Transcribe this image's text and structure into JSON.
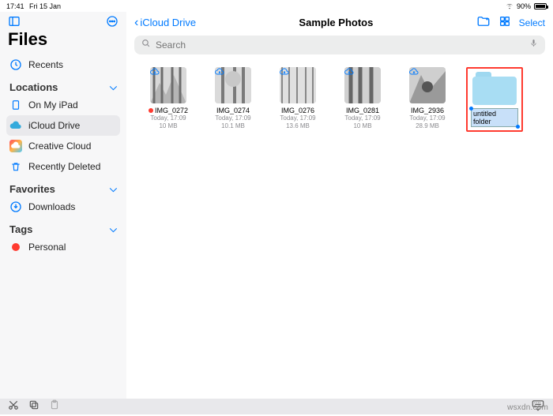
{
  "status": {
    "time": "17:41",
    "date": "Fri 15 Jan",
    "battery": "90%"
  },
  "sidebar": {
    "app": "Files",
    "recents": "Recents",
    "sections": {
      "locations": {
        "title": "Locations",
        "ipad": "On My iPad",
        "icloud": "iCloud Drive",
        "cc": "Creative Cloud",
        "deleted": "Recently Deleted"
      },
      "favorites": {
        "title": "Favorites",
        "downloads": "Downloads"
      },
      "tags": {
        "title": "Tags",
        "personal": "Personal"
      }
    }
  },
  "nav": {
    "back": "iCloud Drive",
    "title": "Sample Photos",
    "select": "Select"
  },
  "search": {
    "placeholder": "Search"
  },
  "files": [
    {
      "name": "IMG_0272",
      "date": "Today, 17:09",
      "size": "10 MB",
      "tagged": true
    },
    {
      "name": "IMG_0274",
      "date": "Today, 17:09",
      "size": "10.1 MB",
      "tagged": false
    },
    {
      "name": "IMG_0276",
      "date": "Today, 17:09",
      "size": "13.6 MB",
      "tagged": false
    },
    {
      "name": "IMG_0281",
      "date": "Today, 17:09",
      "size": "10 MB",
      "tagged": false
    },
    {
      "name": "IMG_2936",
      "date": "Today, 17:09",
      "size": "28.9 MB",
      "tagged": false
    }
  ],
  "newFolder": {
    "name": "untitled folder"
  },
  "watermark": "wsxdn.com"
}
